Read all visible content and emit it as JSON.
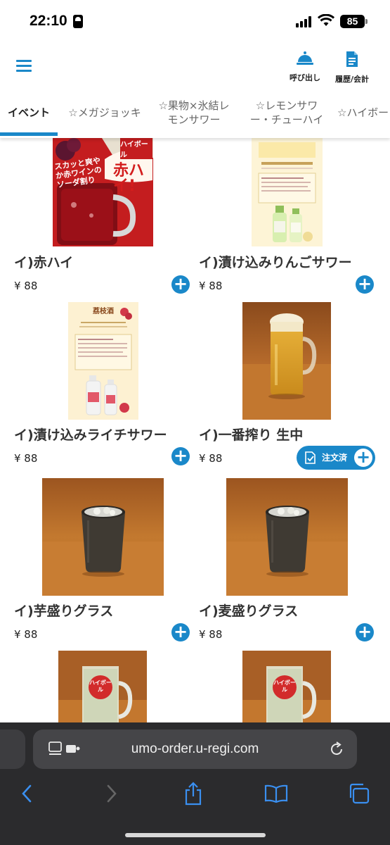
{
  "status_bar": {
    "time": "22:10",
    "battery": "85"
  },
  "header": {
    "call_label": "呼び出し",
    "history_label": "履歴/会計"
  },
  "tabs": [
    {
      "label": "イベント",
      "active": true
    },
    {
      "label": "☆メガジョッキ",
      "active": false
    },
    {
      "label": "☆果物×氷結レモンサワー",
      "active": false
    },
    {
      "label": "☆レモンサワー・チューハイ",
      "active": false
    },
    {
      "label": "☆ハイボー",
      "active": false
    }
  ],
  "products": [
    {
      "name": "イ)赤ハイ",
      "price": "¥ 88",
      "image": "red-highball-poster",
      "image_text": "ハイボール 赤ハイ! スカッと爽やか赤ワインのソーダ割り"
    },
    {
      "name": "イ)漬け込みりんごサワー",
      "price": "¥ 88",
      "image": "apple-sour-poster",
      "image_text": ""
    },
    {
      "name": "イ)漬け込みライチサワー",
      "price": "¥ 88",
      "image": "lychee-sour-poster",
      "image_text": "荔枝酒"
    },
    {
      "name": "イ)一番搾り 生中",
      "price": "¥ 88",
      "image": "draft-beer-photo",
      "image_text": "",
      "ordered_label": "注文済"
    },
    {
      "name": "イ)芋盛りグラス",
      "price": "¥ 88",
      "image": "shochu-glass-photo",
      "image_text": ""
    },
    {
      "name": "イ)麦盛りグラス",
      "price": "¥ 88",
      "image": "shochu-glass-photo",
      "image_text": ""
    },
    {
      "name": "",
      "price": "",
      "image": "highball-mug-photo",
      "image_text": "ハイボール"
    },
    {
      "name": "",
      "price": "",
      "image": "highball-mug-photo",
      "image_text": "ハイボール"
    }
  ],
  "browser": {
    "url": "umo-order.u-regi.com"
  },
  "colors": {
    "accent": "#1a88c9",
    "wood": "#b6692a",
    "safari_bg": "#2b2b2d"
  },
  "icons": [
    "hamburger-menu-icon",
    "bell-icon",
    "document-icon",
    "plus-icon",
    "check-document-icon",
    "reload-icon",
    "back-icon",
    "forward-icon",
    "share-icon",
    "bookmarks-icon",
    "tabs-icon"
  ]
}
